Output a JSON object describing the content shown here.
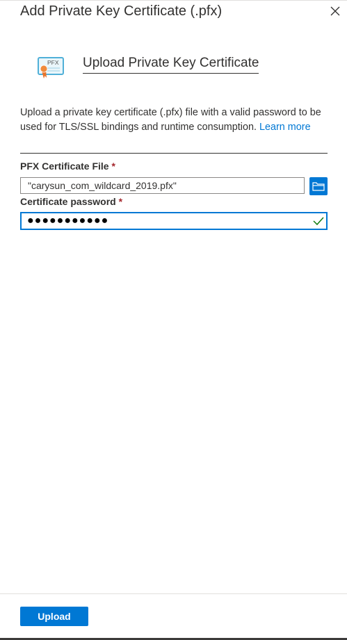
{
  "blade": {
    "title": "Add Private Key Certificate (.pfx)",
    "close_icon": "close-icon"
  },
  "header": {
    "icon": "pfx-certificate-icon",
    "icon_text": "PFX",
    "heading": "Upload Private Key Certificate"
  },
  "description": {
    "text": "Upload a private key certificate (.pfx) file with a valid password to be used for TLS/SSL bindings and runtime consumption.",
    "link_label": "Learn more"
  },
  "form": {
    "pfx_file": {
      "label": "PFX Certificate File",
      "required_marker": "*",
      "value": "\"carysun_com_wildcard_2019.pfx\"",
      "browse_icon": "folder-icon"
    },
    "password": {
      "label": "Certificate password",
      "required_marker": "*",
      "value": "●●●●●●●●●●●",
      "status_icon": "checkmark-icon"
    }
  },
  "footer": {
    "upload_label": "Upload"
  },
  "colors": {
    "accent": "#0078d4",
    "required": "#a4262c",
    "valid": "#107c10",
    "icon_orange": "#e8732a"
  }
}
